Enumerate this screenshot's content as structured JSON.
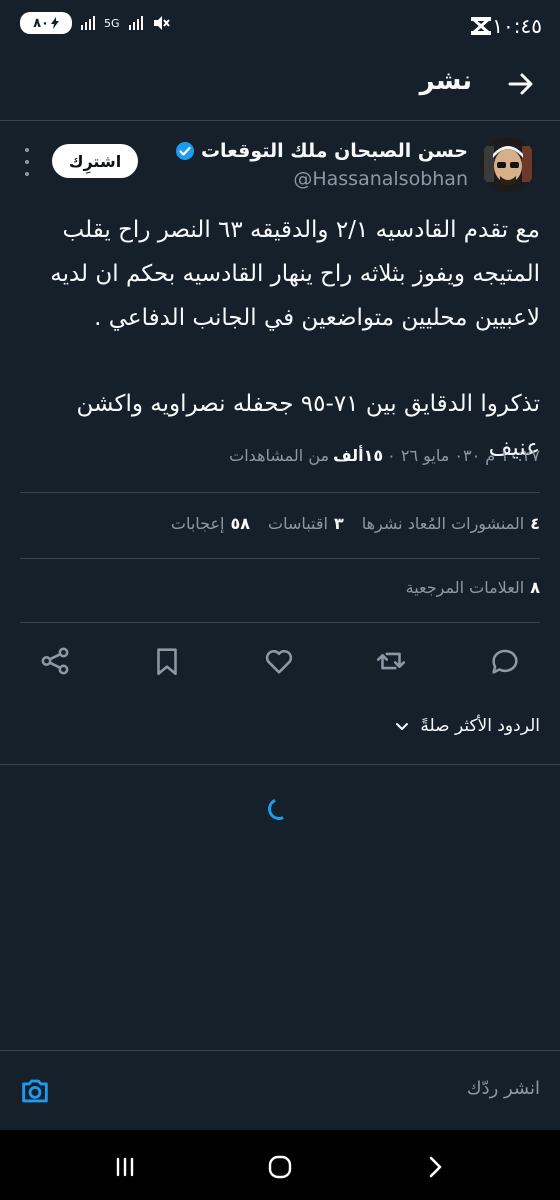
{
  "status_bar": {
    "time": "١٠:٤٥",
    "battery": "٨٠",
    "network": "5G"
  },
  "header": {
    "title": "نشر"
  },
  "tweet": {
    "author_name": "حسن الصبحان ملك التوقعات",
    "handle": "@Hassanalsobhan",
    "subscribe_label": "اشترِك",
    "text_paragraph_1": [
      "مع تقدم القادسيه ٢/١ والدقيقه ٦٣ النصر راح يقلب",
      "المتيجه ويفوز بثلاثه راح ينهار القادسيه بحكم ان لديه",
      "لاعبيين محليين متواضعين في الجانب الدفاعي ."
    ],
    "text_paragraph_2": "تذكروا الدقايق بين ٧١-٩٥ جحفله نصراويه واكشن عنيف",
    "timestamp": "١٠:٢٧ م ٠٣٠ مايو ٢٦ ٠",
    "views_count": "١٥ألف",
    "views_label": "من المشاهدات"
  },
  "stats": {
    "reposts_count": "٤",
    "reposts_label": "المنشورات المُعاد نشرها",
    "quotes_count": "٣",
    "quotes_label": "اقتباسات",
    "likes_count": "٥٨",
    "likes_label": "إعجابات",
    "bookmarks_count": "٨",
    "bookmarks_label": "العلامات المرجعية"
  },
  "replies": {
    "sort_label": "الردود الأكثر صلةً"
  },
  "composer": {
    "placeholder": "انشر ردّك"
  },
  "colors": {
    "background": "#15202b",
    "accent": "#1d9bf0",
    "muted": "#8b98a5",
    "divider": "#38444d"
  },
  "icons": [
    "back-arrow-icon",
    "verified-badge-icon",
    "more-vert-icon",
    "reply-icon",
    "repost-icon",
    "like-icon",
    "bookmark-icon",
    "share-icon",
    "chevron-down-icon",
    "camera-icon",
    "recent-apps-icon",
    "home-icon",
    "nav-back-icon"
  ]
}
